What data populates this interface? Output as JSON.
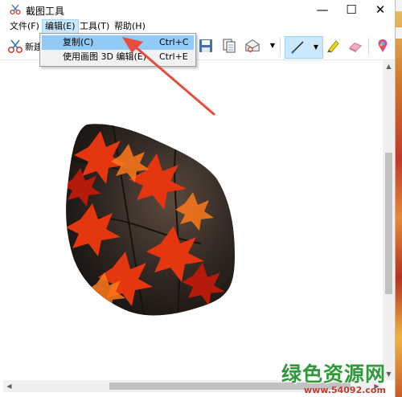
{
  "window": {
    "title": "截图工具",
    "controls": {
      "minimize": "—",
      "maximize": "☐",
      "close": "✕"
    }
  },
  "menubar": {
    "items": [
      {
        "label": "文件(F)"
      },
      {
        "label": "编辑(E)"
      },
      {
        "label": "工具(T)"
      },
      {
        "label": "帮助(H)"
      }
    ]
  },
  "toolbar": {
    "new_label": "新建",
    "icons": [
      "scissors-icon",
      "save-icon",
      "copy-icon",
      "send-email-icon",
      "pen-icon",
      "highlighter-icon",
      "eraser-icon",
      "paint-3d-icon"
    ]
  },
  "dropdown": {
    "items": [
      {
        "label": "复制(C)",
        "shortcut": "Ctrl+C"
      },
      {
        "label": "使用画图 3D 编辑(E)",
        "shortcut": "Ctrl+E"
      }
    ]
  },
  "watermark": {
    "title": "绿色资源网",
    "url": "www.54092.com"
  },
  "colors": {
    "menu_highlight": "#cce8ff",
    "dropdown_highlight": "#91c9f7",
    "arrow": "#e74c3c",
    "watermark_green": "#2e9a3a",
    "watermark_red": "#c0392b"
  }
}
